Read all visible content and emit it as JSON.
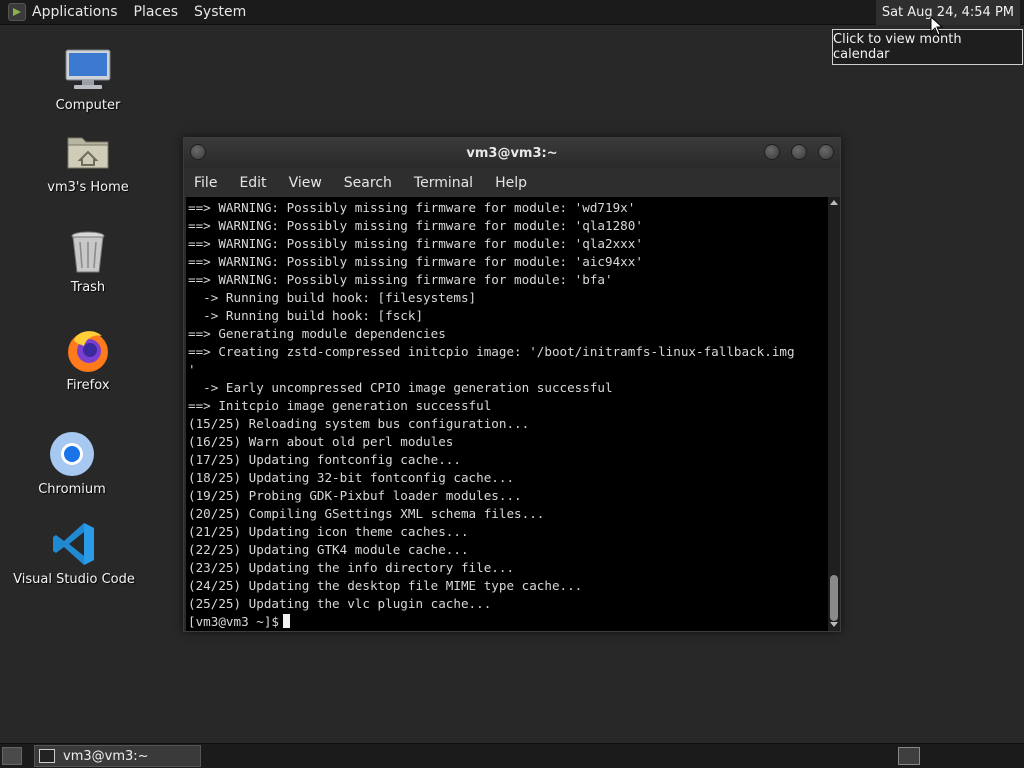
{
  "top_panel": {
    "menus": [
      "Applications",
      "Places",
      "System"
    ],
    "clock": "Sat Aug 24,  4:54 PM",
    "clock_tooltip": "Click to view month calendar"
  },
  "desktop_icons": [
    {
      "label": "Computer",
      "icon": "computer-icon"
    },
    {
      "label": "vm3's Home",
      "icon": "home-folder-icon"
    },
    {
      "label": "Trash",
      "icon": "trash-icon"
    },
    {
      "label": "Firefox",
      "icon": "firefox-icon"
    },
    {
      "label": "Chromium",
      "icon": "chromium-icon"
    },
    {
      "label": "Visual Studio Code",
      "icon": "vscode-icon"
    }
  ],
  "terminal": {
    "title": "vm3@vm3:~",
    "menu": [
      "File",
      "Edit",
      "View",
      "Search",
      "Terminal",
      "Help"
    ],
    "lines": [
      "==> WARNING: Possibly missing firmware for module: 'wd719x'",
      "==> WARNING: Possibly missing firmware for module: 'qla1280'",
      "==> WARNING: Possibly missing firmware for module: 'qla2xxx'",
      "==> WARNING: Possibly missing firmware for module: 'aic94xx'",
      "==> WARNING: Possibly missing firmware for module: 'bfa'",
      "  -> Running build hook: [filesystems]",
      "  -> Running build hook: [fsck]",
      "==> Generating module dependencies",
      "==> Creating zstd-compressed initcpio image: '/boot/initramfs-linux-fallback.img",
      "'",
      "  -> Early uncompressed CPIO image generation successful",
      "==> Initcpio image generation successful",
      "(15/25) Reloading system bus configuration...",
      "(16/25) Warn about old perl modules",
      "(17/25) Updating fontconfig cache...",
      "(18/25) Updating 32-bit fontconfig cache...",
      "(19/25) Probing GDK-Pixbuf loader modules...",
      "(20/25) Compiling GSettings XML schema files...",
      "(21/25) Updating icon theme caches...",
      "(22/25) Updating GTK4 module cache...",
      "(23/25) Updating the info directory file...",
      "(24/25) Updating the desktop file MIME type cache...",
      "(25/25) Updating the vlc plugin cache..."
    ],
    "prompt": "[vm3@vm3 ~]$"
  },
  "taskbar": {
    "tasks": [
      {
        "label": "vm3@vm3:~",
        "icon": "terminal-icon"
      }
    ]
  }
}
